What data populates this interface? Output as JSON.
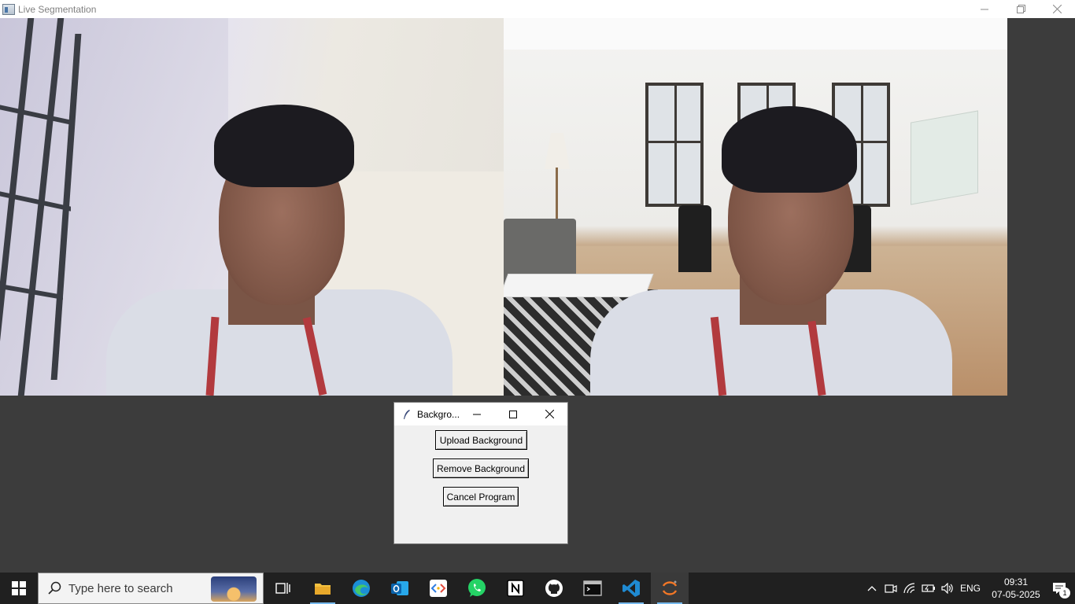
{
  "main_window": {
    "title": "Live Segmentation"
  },
  "dialog": {
    "title": "Backgro...",
    "buttons": {
      "upload": "Upload Background",
      "remove": "Remove Background",
      "cancel": "Cancel Program"
    }
  },
  "taskbar": {
    "search_placeholder": "Type here to search",
    "pinned_apps": [
      "task-view",
      "file-explorer",
      "edge",
      "outlook",
      "code-app",
      "whatsapp",
      "notion",
      "github",
      "terminal",
      "vscode",
      "python-tk"
    ],
    "tray": {
      "language": "ENG",
      "time": "09:31",
      "date": "07-05-2025",
      "notification_count": "1"
    }
  },
  "colors": {
    "background": "#3c3c3c",
    "taskbar": "#202020",
    "accent": "#76b9ed"
  }
}
